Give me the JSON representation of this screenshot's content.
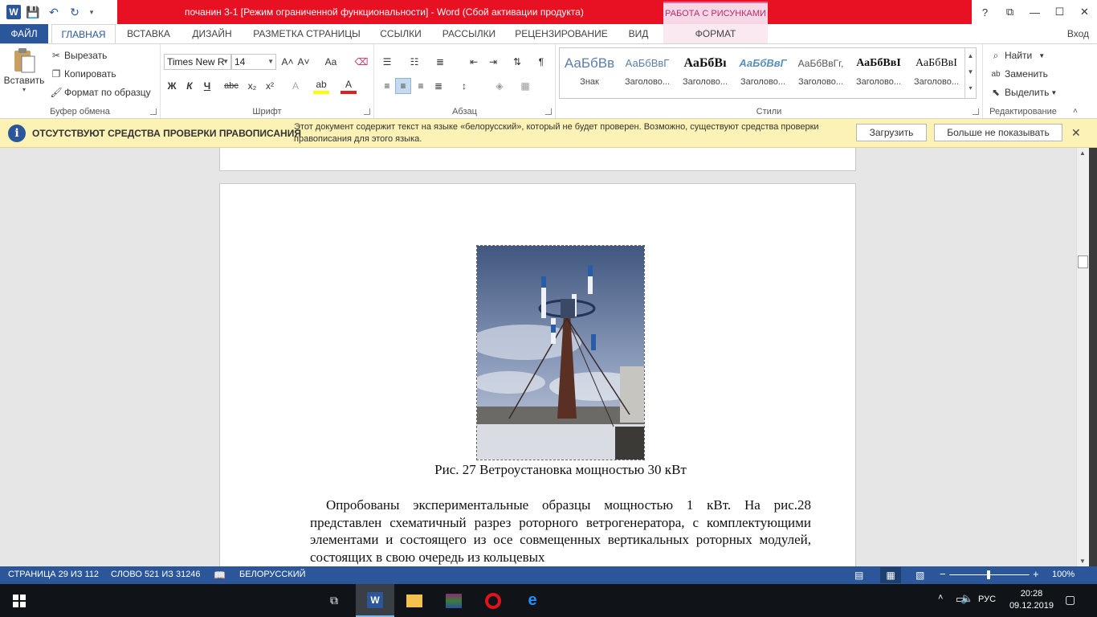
{
  "window": {
    "title": "почанин 3-1 [Режим ограниченной функциональности]  -  Word (Сбой активации продукта)",
    "context_tab_group": "РАБОТА С РИСУНКАМИ",
    "help": "?",
    "restore_ribbon": "⧉",
    "minimize": "—",
    "maximize": "☐",
    "close": "✕"
  },
  "qat": {
    "save": "💾",
    "undo": "↶",
    "redo": "↻",
    "customize": "▾"
  },
  "tabs": [
    "ФАЙЛ",
    "ГЛАВНАЯ",
    "ВСТАВКА",
    "ДИЗАЙН",
    "РАЗМЕТКА СТРАНИЦЫ",
    "ССЫЛКИ",
    "РАССЫЛКИ",
    "РЕЦЕНЗИРОВАНИЕ",
    "ВИД",
    "ФОРМАТ"
  ],
  "sign_in": "Вход",
  "clipboard": {
    "paste": "Вставить",
    "cut": "Вырезать",
    "copy": "Копировать",
    "format_painter": "Формат по образцу",
    "label": "Буфер обмена"
  },
  "font": {
    "name": "Times New R",
    "size": "14",
    "grow": "A˄",
    "shrink": "A˅",
    "case": "Aa",
    "bold": "Ж",
    "italic": "К",
    "underline": "Ч",
    "strike": "abc",
    "subscript": "x₂",
    "superscript": "x²",
    "label": "Шрифт"
  },
  "paragraph": {
    "label": "Абзац",
    "pilcrow": "¶"
  },
  "styles": {
    "label": "Стили",
    "items": [
      {
        "sample": "АаБбВв",
        "name": "Знак"
      },
      {
        "sample": "АаБбВвГ",
        "name": "Заголово..."
      },
      {
        "sample": "АаБбВı",
        "name": "Заголово..."
      },
      {
        "sample": "АаБбВвГ",
        "name": "Заголово..."
      },
      {
        "sample": "АаБбВвГг,",
        "name": "Заголово..."
      },
      {
        "sample": "АаБбВвI",
        "name": "Заголово..."
      },
      {
        "sample": "АаБбВвI",
        "name": "Заголово..."
      }
    ]
  },
  "editing": {
    "find": "Найти",
    "replace": "Заменить",
    "select": "Выделить",
    "label": "Редактирование"
  },
  "message_bar": {
    "title": "ОТСУТСТВУЮТ СРЕДСТВА ПРОВЕРКИ ПРАВОПИСАНИЯ",
    "text": "Этот документ содержит текст на языке «белорусский», который не будет проверен. Возможно, существуют средства проверки правописания для этого языка.",
    "download": "Загрузить",
    "dont_show": "Больше не показывать",
    "close": "✕"
  },
  "document": {
    "caption": "Рис. 27 Ветроустановка мощностью 30 кВт",
    "paragraph": "Опробованы экспериментальные образцы мощностью 1 кВт. На рис.28 представлен схематичный разрез роторного ветрогенератора, с комплектующими элементами и состоящего из осе совмещенных вертикальных роторных модулей, состоящих в свою очередь из кольцевых"
  },
  "status": {
    "page": "СТРАНИЦА 29 ИЗ 112",
    "words": "СЛОВО 521 ИЗ 31246",
    "language": "БЕЛОРУССКИЙ",
    "zoom": "100%",
    "zoom_level_percent": 100,
    "zoom_minus": "−",
    "zoom_plus": "+"
  },
  "taskbar": {
    "time": "20:28",
    "date": "09.12.2019",
    "lang": "РУС"
  }
}
